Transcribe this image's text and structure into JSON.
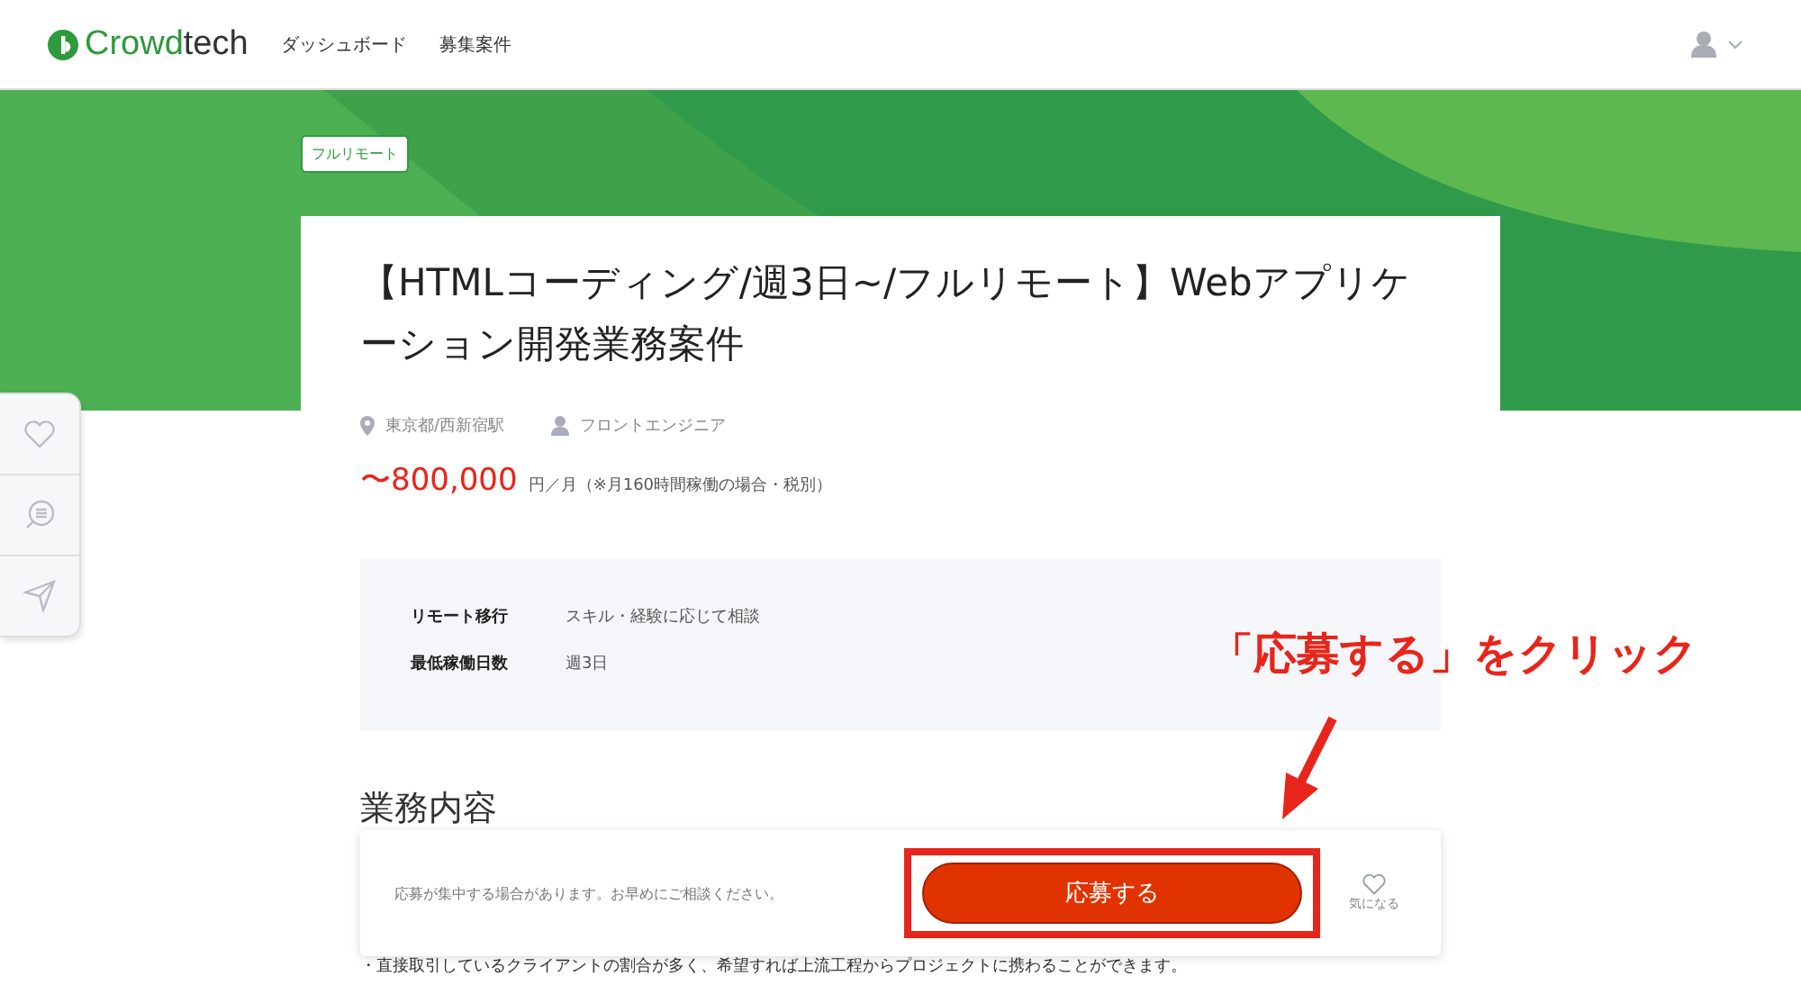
{
  "header": {
    "logo_a": "Crowd",
    "logo_b": "tech",
    "nav": [
      {
        "label": "ダッシュボード"
      },
      {
        "label": "募集案件"
      }
    ]
  },
  "job": {
    "tag": "フルリモート",
    "title": "【HTMLコーディング/週3日~/フルリモート】Webアプリケーション開発業務案件",
    "location": "東京都/西新宿駅",
    "role": "フロントエンジニア",
    "price": "〜800,000",
    "price_note": "円／月（※月160時間稼働の場合・税別）",
    "conditions": [
      {
        "label": "リモート移行",
        "value": "スキル・経験に応じて相談"
      },
      {
        "label": "最低稼働日数",
        "value": "週3日"
      }
    ],
    "section_heading": "業務内容",
    "bullet": "・直接取引しているクライアントの割合が多く、希望すれば上流工程からプロジェクトに携わることができます。"
  },
  "apply_bar": {
    "note": "応募が集中する場合があります。お早めにご相談ください。",
    "button": "応募する",
    "favorite": "気になる"
  },
  "annotation": {
    "text": "「応募する」をクリック"
  }
}
